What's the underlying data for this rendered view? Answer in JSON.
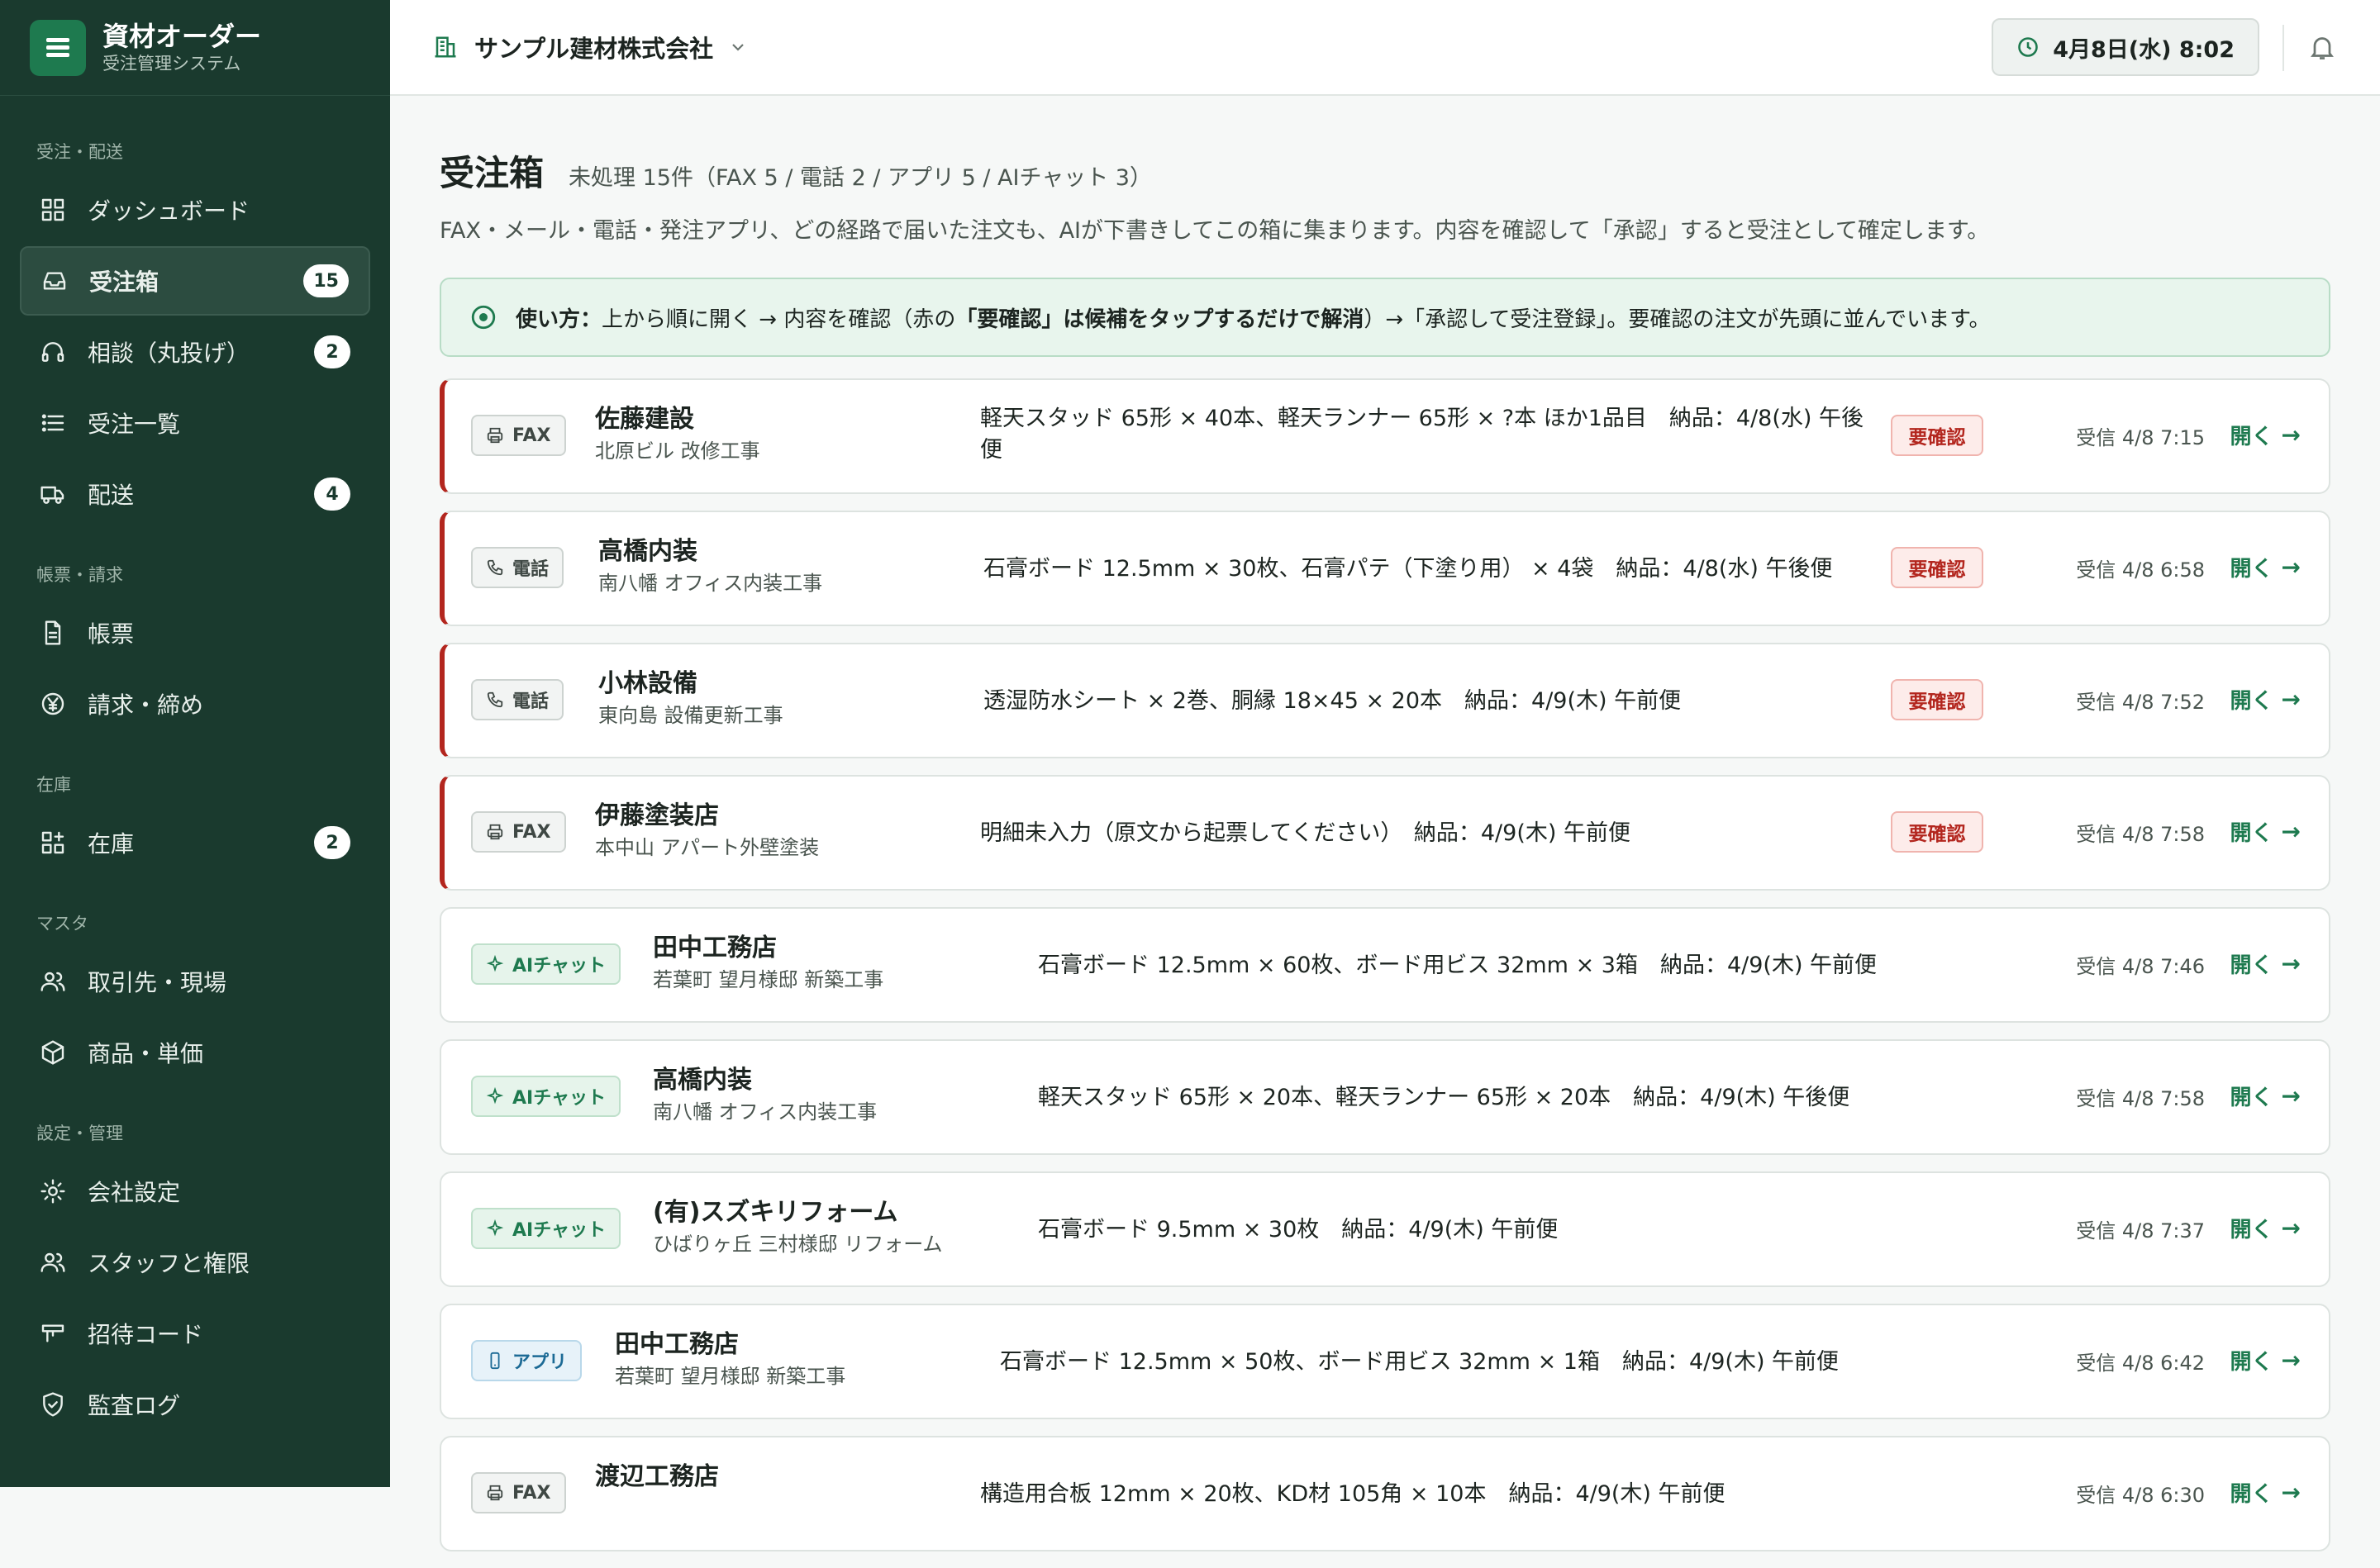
{
  "brand": {
    "title": "資材オーダー",
    "subtitle": "受注管理システム"
  },
  "sidebar": {
    "sections": [
      {
        "label": "受注・配送",
        "items": [
          {
            "label": "ダッシュボード",
            "icon": "dashboard-icon"
          },
          {
            "label": "受注箱",
            "icon": "inbox-icon",
            "badge": "15",
            "active": true
          },
          {
            "label": "相談（丸投げ）",
            "icon": "headset-icon",
            "badge": "2"
          },
          {
            "label": "受注一覧",
            "icon": "list-icon"
          },
          {
            "label": "配送",
            "icon": "truck-icon",
            "badge": "4"
          }
        ]
      },
      {
        "label": "帳票・請求",
        "items": [
          {
            "label": "帳票",
            "icon": "document-icon"
          },
          {
            "label": "請求・締め",
            "icon": "yen-icon"
          }
        ]
      },
      {
        "label": "在庫",
        "items": [
          {
            "label": "在庫",
            "icon": "inventory-icon",
            "badge": "2"
          }
        ]
      },
      {
        "label": "マスタ",
        "items": [
          {
            "label": "取引先・現場",
            "icon": "users-icon"
          },
          {
            "label": "商品・単価",
            "icon": "box-icon"
          }
        ]
      },
      {
        "label": "設定・管理",
        "items": [
          {
            "label": "会社設定",
            "icon": "gear-icon"
          },
          {
            "label": "スタッフと権限",
            "icon": "staff-icon"
          },
          {
            "label": "招待コード",
            "icon": "ticket-icon"
          },
          {
            "label": "監査ログ",
            "icon": "shield-icon"
          }
        ]
      }
    ]
  },
  "topbar": {
    "company": "サンプル建材株式会社",
    "datetime": "4月8日(水) 8:02"
  },
  "page": {
    "title": "受注箱",
    "summary": "未処理 15件（FAX 5 / 電話 2 / アプリ 5 / AIチャット 3）",
    "description": "FAX・メール・電話・発注アプリ、どの経路で届いた注文も、AIが下書きしてこの箱に集まります。内容を確認して「承認」すると受注として確定します。",
    "howto_label": "使い方：",
    "howto_part1": "上から順に開く → 内容を確認（赤の",
    "howto_bold": "「要確認」は候補をタップするだけで解消",
    "howto_part2": "）→「承認して受注登録」。要確認の注文が先頭に並んでいます。"
  },
  "labels": {
    "open": "開く",
    "needs_check": "要確認"
  },
  "orders": [
    {
      "channel": "FAX",
      "channel_type": "fax",
      "customer": "佐藤建設",
      "site": "北原ビル 改修工事",
      "detail": "軽天スタッド 65形 × 40本、軽天ランナー 65形 × ?本 ほか1品目　納品：4/8(水) 午後便",
      "received": "受信 4/8 7:15",
      "needs_check": true
    },
    {
      "channel": "電話",
      "channel_type": "tel",
      "customer": "高橋内装",
      "site": "南八幡 オフィス内装工事",
      "detail": "石膏ボード 12.5mm × 30枚、石膏パテ（下塗り用） × 4袋　納品：4/8(水) 午後便",
      "received": "受信 4/8 6:58",
      "needs_check": true
    },
    {
      "channel": "電話",
      "channel_type": "tel",
      "customer": "小林設備",
      "site": "東向島 設備更新工事",
      "detail": "透湿防水シート × 2巻、胴縁 18×45 × 20本　納品：4/9(木) 午前便",
      "received": "受信 4/8 7:52",
      "needs_check": true
    },
    {
      "channel": "FAX",
      "channel_type": "fax",
      "customer": "伊藤塗装店",
      "site": "本中山 アパート外壁塗装",
      "detail": "明細未入力（原文から起票してください）　納品：4/9(木) 午前便",
      "received": "受信 4/8 7:58",
      "needs_check": true
    },
    {
      "channel": "AIチャット",
      "channel_type": "ai",
      "customer": "田中工務店",
      "site": "若葉町 望月様邸 新築工事",
      "detail": "石膏ボード 12.5mm × 60枚、ボード用ビス 32mm × 3箱　納品：4/9(木) 午前便",
      "received": "受信 4/8 7:46",
      "needs_check": false
    },
    {
      "channel": "AIチャット",
      "channel_type": "ai",
      "customer": "高橋内装",
      "site": "南八幡 オフィス内装工事",
      "detail": "軽天スタッド 65形 × 20本、軽天ランナー 65形 × 20本　納品：4/9(木) 午後便",
      "received": "受信 4/8 7:58",
      "needs_check": false
    },
    {
      "channel": "AIチャット",
      "channel_type": "ai",
      "customer": "(有)スズキリフォーム",
      "site": "ひばりヶ丘 三村様邸 リフォーム",
      "detail": "石膏ボード 9.5mm × 30枚　納品：4/9(木) 午前便",
      "received": "受信 4/8 7:37",
      "needs_check": false
    },
    {
      "channel": "アプリ",
      "channel_type": "app",
      "customer": "田中工務店",
      "site": "若葉町 望月様邸 新築工事",
      "detail": "石膏ボード 12.5mm × 50枚、ボード用ビス 32mm × 1箱　納品：4/9(木) 午前便",
      "received": "受信 4/8 6:42",
      "needs_check": false
    },
    {
      "channel": "FAX",
      "channel_type": "fax",
      "customer": "渡辺工務店",
      "site": "",
      "detail": "構造用合板 12mm × 20枚、KD材 105角 × 10本　納品：4/9(木) 午前便",
      "received": "受信 4/8 6:30",
      "needs_check": false
    }
  ]
}
